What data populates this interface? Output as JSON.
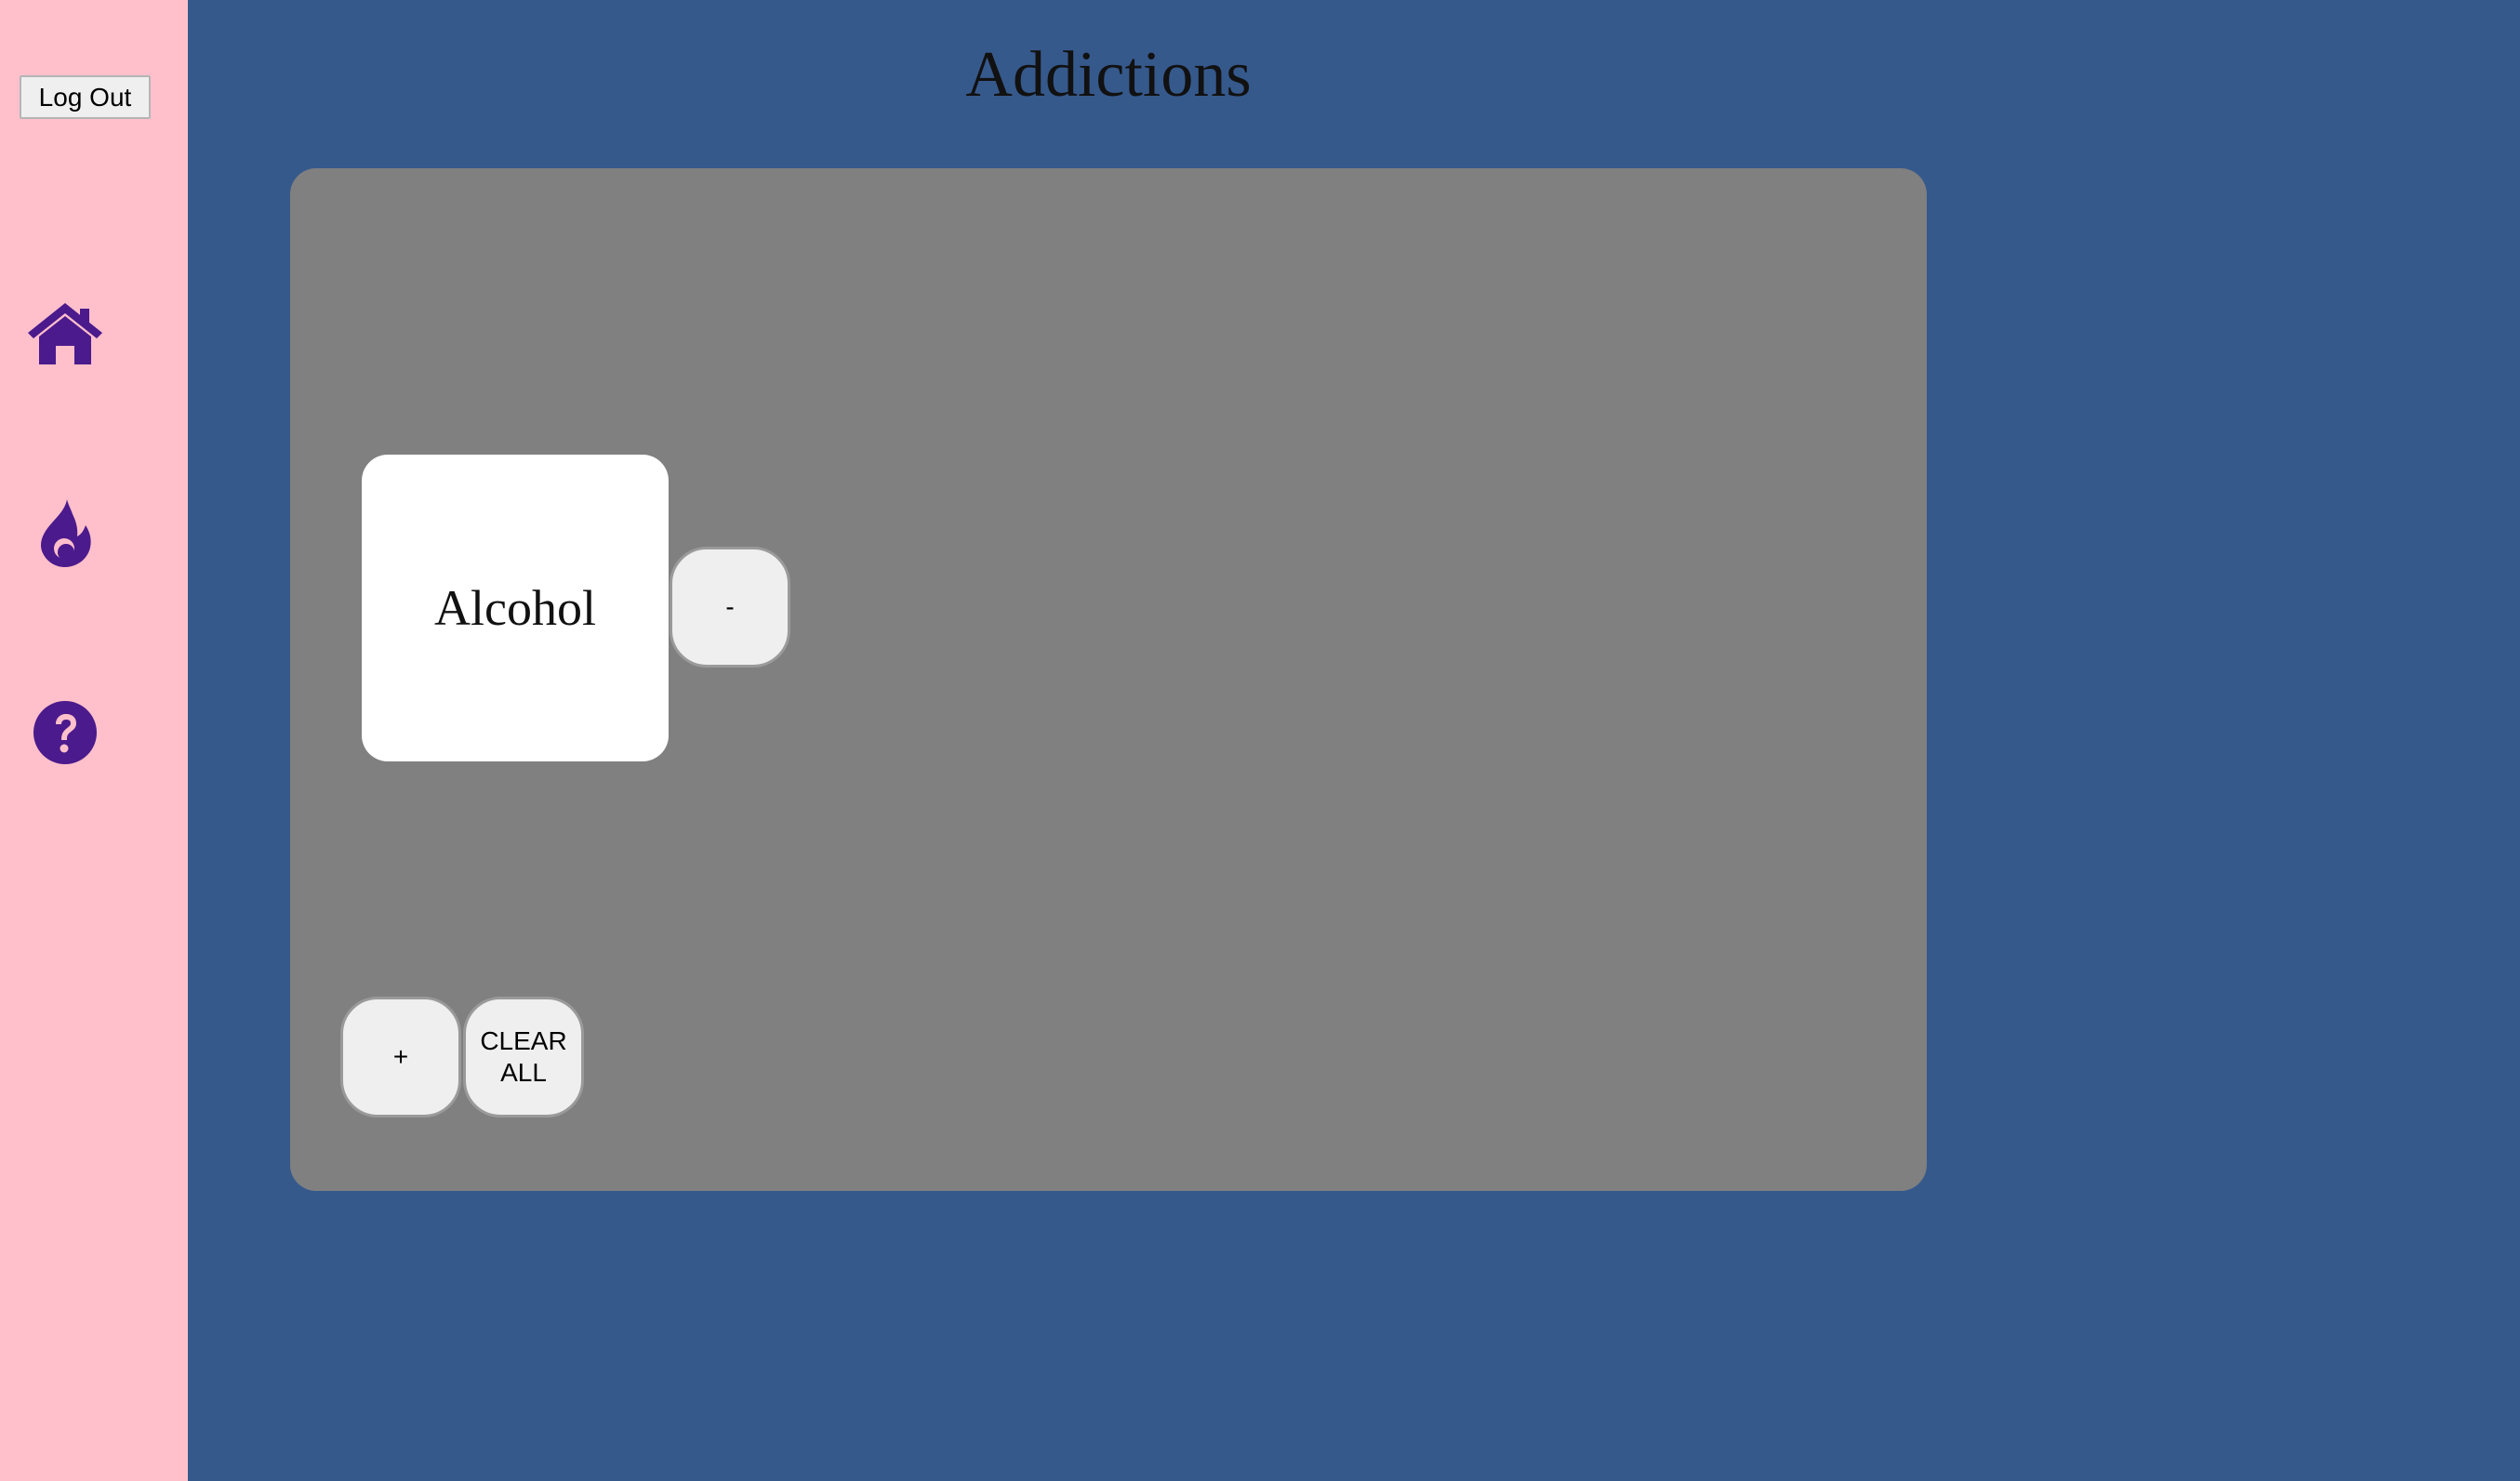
{
  "sidebar": {
    "logout_label": "Log Out",
    "icons": [
      {
        "name": "home-icon",
        "color": "#4b1a8c"
      },
      {
        "name": "fire-icon",
        "color": "#4b1a8c"
      },
      {
        "name": "help-icon",
        "color": "#4b1a8c"
      }
    ]
  },
  "page": {
    "title": "Addictions"
  },
  "addictions": {
    "items": [
      {
        "label": "Alcohol",
        "remove_label": "-"
      }
    ],
    "add_label": "+",
    "clear_label": "CLEAR ALL"
  },
  "colors": {
    "background": "#36598c",
    "sidebar": "#ffc0cb",
    "panel": "#808080",
    "card": "#ffffff",
    "button": "#efefef",
    "icon": "#4b1a8c"
  }
}
